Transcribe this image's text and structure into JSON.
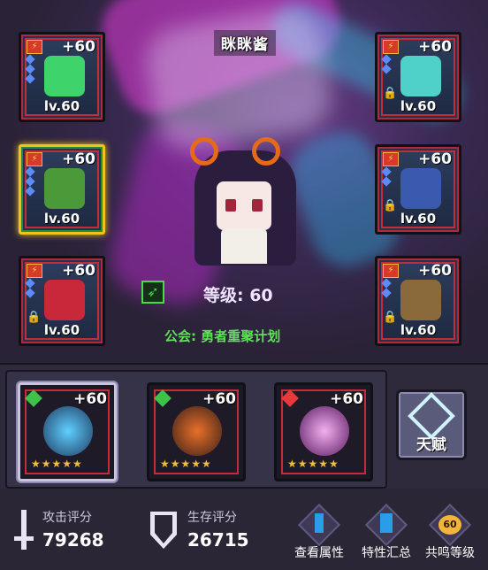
{
  "hero": {
    "name": "眯眯酱",
    "level_text": "等级: 60",
    "guild_text": "公会: 勇者重聚计划"
  },
  "equipment": {
    "left": [
      {
        "plus": "+60",
        "level": "lv.60",
        "color": "#3fd46b"
      },
      {
        "plus": "+60",
        "level": "lv.60",
        "color": "#4a9a3a"
      },
      {
        "plus": "+60",
        "level": "lv.60",
        "color": "#c8283a"
      }
    ],
    "right": [
      {
        "plus": "+60",
        "level": "lv.60",
        "color": "#4fd0c8"
      },
      {
        "plus": "+60",
        "level": "lv.60",
        "color": "#3a5ab0"
      },
      {
        "plus": "+60",
        "level": "lv.60",
        "color": "#8a6a3a"
      }
    ]
  },
  "weapons": [
    {
      "plus": "+60",
      "badge_color": "#3ec24a",
      "art_color": "#5fd0ff"
    },
    {
      "plus": "+60",
      "badge_color": "#3ec24a",
      "art_color": "#e8702a"
    },
    {
      "plus": "+60",
      "badge_color": "#e83a3a",
      "art_color": "#e24ad8"
    }
  ],
  "talent": {
    "label": "天赋"
  },
  "stats": {
    "attack_label": "攻击评分",
    "attack_value": "79268",
    "survival_label": "生存评分",
    "survival_value": "26715"
  },
  "actions": {
    "view_attributes": "查看属性",
    "trait_summary": "特性汇总",
    "resonance_level": "共鸣等级",
    "resonance_value": "60"
  },
  "colors": {
    "accent_green": "#5fe05a",
    "frame_red": "#c42c3a",
    "star_gold": "#f2c037"
  }
}
